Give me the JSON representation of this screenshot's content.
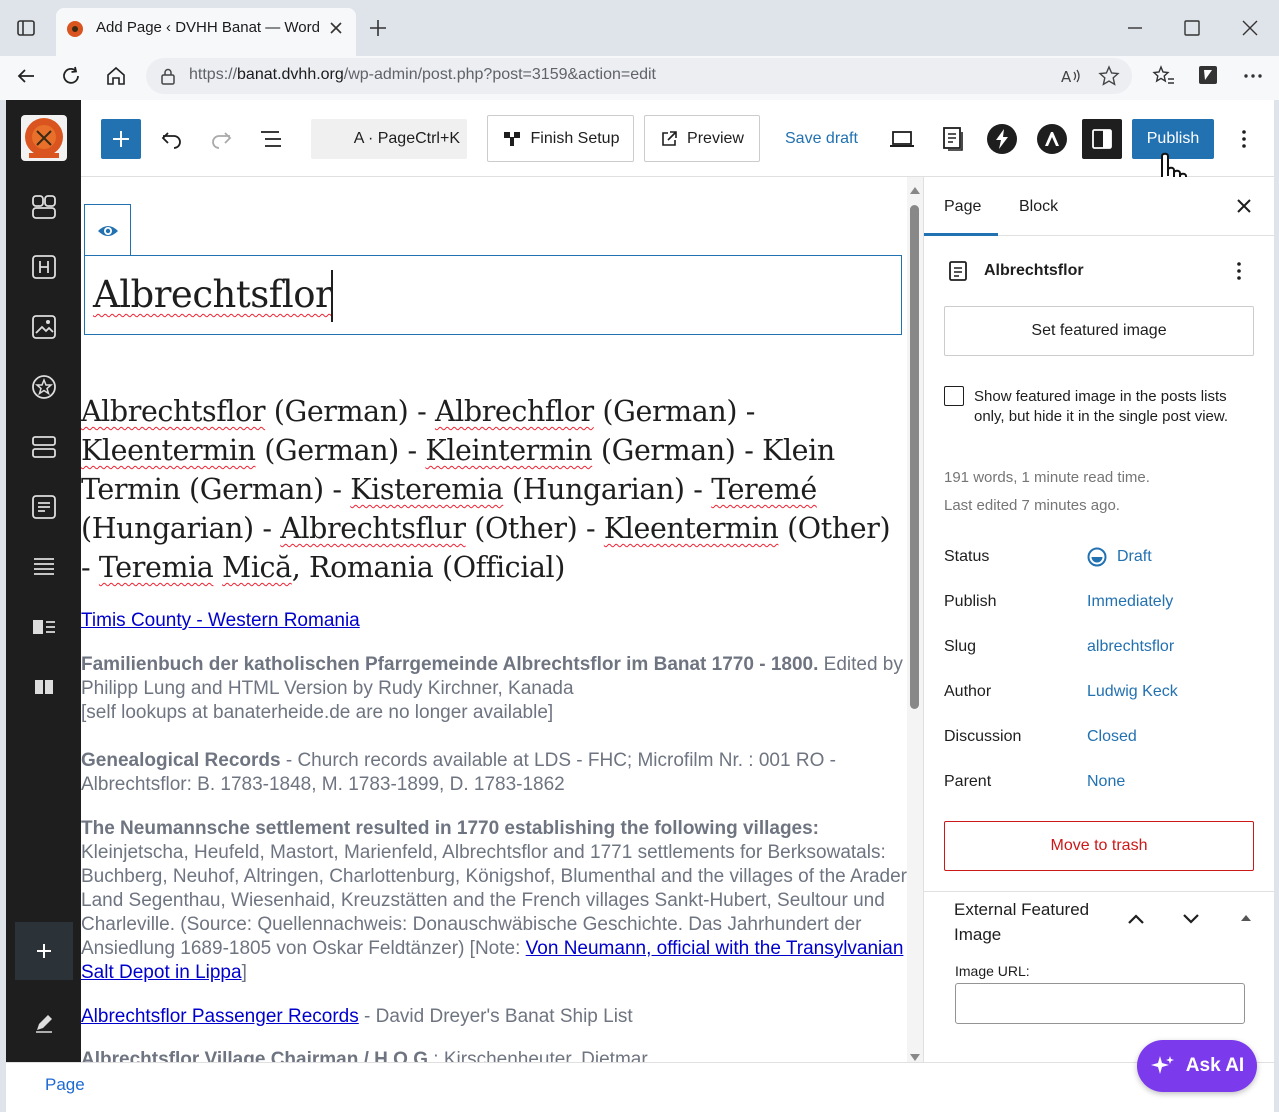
{
  "browser": {
    "tab_title": "Add Page ‹ DVHH Banat — WordPress",
    "url_prefix": "https://",
    "url_host": "banat.dvhh.org",
    "url_path": "/wp-admin/post.php?post=3159&action=edit"
  },
  "toolbar": {
    "command_shortcut": "A · PageCtrl+K",
    "finish_setup": "Finish Setup",
    "preview": "Preview",
    "save_draft": "Save draft",
    "publish": "Publish"
  },
  "editor": {
    "title": "Albrechtsflor",
    "heading_parts": [
      {
        "t": "Albrechtsflor",
        "sp": true
      },
      {
        "t": " (German) - ",
        "sp": false
      },
      {
        "t": "Albrechflor",
        "sp": true
      },
      {
        "t": " (German) - ",
        "sp": false
      },
      {
        "t": "Kleentermin",
        "sp": true
      },
      {
        "t": " (German) - ",
        "sp": false
      },
      {
        "t": "Kleintermin",
        "sp": true
      },
      {
        "t": " (German) - Klein Termin (German) - ",
        "sp": false
      },
      {
        "t": "Kisteremia",
        "sp": true
      },
      {
        "t": " (Hungarian) - ",
        "sp": false
      },
      {
        "t": "Teremé",
        "sp": true
      },
      {
        "t": " (Hungarian) - ",
        "sp": false
      },
      {
        "t": "Albrechtsflur",
        "sp": true
      },
      {
        "t": " (Other) - ",
        "sp": false
      },
      {
        "t": "Kleentermin",
        "sp": true
      },
      {
        "t": " (Other) - ",
        "sp": false
      },
      {
        "t": "Teremia",
        "sp": true
      },
      {
        "t": " ",
        "sp": false
      },
      {
        "t": "Mică",
        "sp": true
      },
      {
        "t": ", Romania (Official)",
        "sp": false
      }
    ],
    "county_link": "Timis County - Western Romania",
    "p1_bold": "Familienbuch der katholischen Pfarrgemeinde Albrechtsflor im Banat 1770 - 1800.",
    "p1_text": " Edited by Philipp Lung and HTML Version by Rudy Kirchner, Kanada",
    "p1_note": "[self lookups at banaterheide.de are no longer available]",
    "p2_bold": "Genealogical Records",
    "p2_text": " - Church records available at LDS - FHC; Microfilm Nr. : 001 RO - Albrechtsflor: B. 1783-1848, M. 1783-1899, D. 1783-1862",
    "p3_bold": "The Neumannsche settlement resulted in 1770 establishing the following villages:",
    "p3_text": " Kleinjetscha, Heufeld, Mastort, Marienfeld, Albrechtsflor and 1771 settlements for Berksowatals: Buchberg, Neuhof, Altringen, Charlottenburg, Königshof, Blumenthal and the villages of the Arader Land Segenthau, Wiesenhaid, Kreuzstätten and the French villages Sankt-Hubert, Seultour und Charleville. (Source: Quellennachweis: Donauschwäbische Geschichte. Das Jahrhundert der Ansiedlung 1689-1805 von Oskar Feldtänzer) [Note: ",
    "p3_link": "Von Neumann, official with the Transylvanian Salt Depot in Lippa",
    "p3_end": "]",
    "p4_link": "Albrechtsflor Passenger Records",
    "p4_text": " - David Dreyer's Banat Ship List",
    "p5_bold": "Albrechtsflor Village Chairman / H.O.G.",
    "p5_text": ": Kirschenheuter, Dietmar"
  },
  "sidebar": {
    "tab_page": "Page",
    "tab_block": "Block",
    "doc_title": "Albrechtsflor",
    "set_featured": "Set featured image",
    "checkbox_label": "Show featured image in the posts lists only, but hide it in the single post view.",
    "meta_words": "191 words, 1 minute read time.",
    "meta_edited": "Last edited 7 minutes ago.",
    "rows": [
      {
        "label": "Status",
        "value": "Draft"
      },
      {
        "label": "Publish",
        "value": "Immediately"
      },
      {
        "label": "Slug",
        "value": "albrechtsflor"
      },
      {
        "label": "Author",
        "value": "Ludwig Keck"
      },
      {
        "label": "Discussion",
        "value": "Closed"
      },
      {
        "label": "Parent",
        "value": "None"
      }
    ],
    "trash": "Move to trash",
    "ext_title": "External Featured Image",
    "ext_url_label": "Image URL:"
  },
  "footer": {
    "breadcrumb": "Page"
  },
  "ask_ai": "Ask AI",
  "colors": {
    "accent": "#2271b1",
    "danger": "#cc1818",
    "askai": "#7c3aed"
  }
}
